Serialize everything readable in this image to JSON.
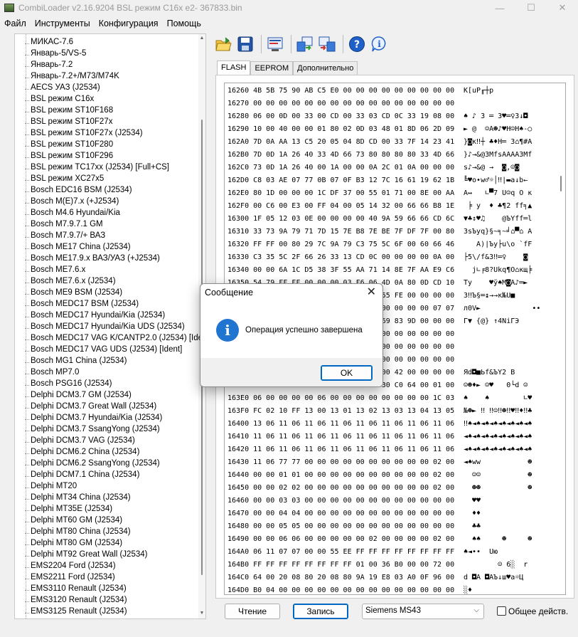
{
  "window": {
    "title": "CombiLoader v2.16.9204 BSL режим C16x e2- 367833.bin",
    "minimize": "—",
    "maximize": "☐",
    "close": "✕"
  },
  "menu": [
    "Файл",
    "Инструменты",
    "Конфигурация",
    "Помощь"
  ],
  "tree_items": [
    "МИКАС-7.6",
    "Январь-5/VS-5",
    "Январь-7.2",
    "Январь-7.2+/M73/M74K",
    "AECS УАЗ (J2534)",
    "BSL режим C16x",
    "BSL режим ST10F168",
    "BSL режим ST10F27x",
    "BSL режим ST10F27x (J2534)",
    "BSL режим ST10F280",
    "BSL режим ST10F296",
    "BSL режим TC17xx (J2534) [Full+CS]",
    "BSL режим XC27x5",
    "Bosch EDC16 BSM (J2534)",
    "Bosch M(E)7.x (+J2534)",
    "Bosch M4.6 Hyundai/Kia",
    "Bosch M7.9.7.1 GM",
    "Bosch M7.9.7/+ ВАЗ",
    "Bosch ME17 China (J2534)",
    "Bosch ME17.9.x ВАЗ/УАЗ (+J2534)",
    "Bosch ME7.6.x",
    "Bosch ME7.6.x (J2534)",
    "Bosch ME9 BSM (J2534)",
    "Bosch MEDC17 BSM (J2534)",
    "Bosch MEDC17 Hyundai/Kia (J2534)",
    "Bosch MEDC17 Hyundai/Kia UDS (J2534)",
    "Bosch MEDC17 VAG K/CANTP2.0 (J2534) [Ident]",
    "Bosch MEDC17 VAG UDS (J2534) [Ident]",
    "Bosch MG1 China (J2534)",
    "Bosch MP7.0",
    "Bosch PSG16 (J2534)",
    "Delphi DCM3.7 GM (J2534)",
    "Delphi DCM3.7 Great Wall (J2534)",
    "Delphi DCM3.7 Hyundai/Kia (J2534)",
    "Delphi DCM3.7 SsangYong (J2534)",
    "Delphi DCM3.7 VAG (J2534)",
    "Delphi DCM6.2 China (J2534)",
    "Delphi DCM6.2 SsangYong (J2534)",
    "Delphi DCM7.1 China (J2534)",
    "Delphi MT20",
    "Delphi MT34 China (J2534)",
    "Delphi MT35E (J2534)",
    "Delphi MT60 GM (J2534)",
    "Delphi MT80 China (J2534)",
    "Delphi MT80 GM (J2534)",
    "Delphi MT92 Great Wall (J2534)",
    "EMS2204 Ford (J2534)",
    "EMS2211 Ford (J2534)",
    "EMS3110 Renault (J2534)",
    "EMS3120 Renault (J2534)",
    "EMS3125 Renault (J2534)"
  ],
  "toolbar": [
    "open-icon",
    "save-icon",
    "edit-icon",
    "read-icon",
    "write-icon",
    "help-icon",
    "info-icon"
  ],
  "tabs": [
    "FLASH",
    "EEPROM",
    "Дополнительно"
  ],
  "hex_rows": [
    {
      "hex": "16260 4B 5B 75 90 AB C5 E0 00 00 00 00 00 00 00 00 00",
      "ascii": "K[uP╓┼р"
    },
    {
      "hex": "16270 00 00 00 00 00 00 00 00 00 00 00 00 00 00 00 00",
      "ascii": ""
    },
    {
      "hex": "16280 06 00 0D 00 33 00 CD 00 33 03 CD 0C 33 19 08 00",
      "ascii": "♠ ♪ 3 ═ 3♥═♀3↓◘"
    },
    {
      "hex": "16290 10 00 40 00 00 01 80 02 0D 03 48 01 8D 06 2D 09",
      "ascii": "► @  ☺А☻♪♥H☺Н♠-○"
    },
    {
      "hex": "162A0 7D 0A AA 13 C5 20 05 04 8D CD 00 33 7F 14 23 41",
      "ascii": "}◙к‼┼ ♣♦Н═ 3⌂¶#A"
    },
    {
      "hex": "162B0 7D 0D 1A 26 40 33 4D 66 73 80 80 80 80 33 4D 66",
      "ascii": "}♪→&@3MfsААААЗMf"
    },
    {
      "hex": "162C0 73 0D 1A 26 40 00 1A 00 00 0A 2C 01 0A 00 00 00",
      "ascii": "s♪→&@ →  ◙,☺◙"
    },
    {
      "hex": "162D0 C8 03 AE 07 77 0B 07 0F B3 12 7C 16 61 19 62 1B",
      "ascii": "╚♥о•w♂☼│‼|▬a↓b←"
    },
    {
      "hex": "162E0 80 1D 00 00 00 1C DF 37 00 55 01 71 00 8E 00 AA",
      "ascii": "А↔   ∟▀7 U☺q О к"
    },
    {
      "hex": "162F0 00 C6 00 E3 00 FF 04 00 05 14 32 00 66 66 B8 1E",
      "ascii": " ╞ у  ♦ ♣¶2 ff╕▲"
    },
    {
      "hex": "16300 1F 05 12 03 0E 00 00 00 00 40 9A 59 66 66 CD 6C",
      "ascii": "▼♣↕♥♫    @ЪYff═l"
    },
    {
      "hex": "16310 33 73 9A 79 71 7D 15 7E B8 7E BE 7F DF 7F 00 80",
      "ascii": "3sЪyq}§~╕~╛⌂▀⌂ А"
    },
    {
      "hex": "16320 FF FF 00 80 29 7C 9A 79 C3 75 5C 6F 00 60 66 46",
      "ascii": "   А)|Ъy├u\\o `fF"
    },
    {
      "hex": "16330 C3 35 5C 2F 66 26 33 13 CD 0C 00 00 00 00 0A 00",
      "ascii": "├5\\/f&3‼═♀    ◙"
    },
    {
      "hex": "16340 00 00 6A 1C D5 38 3F 55 AA 71 14 8E 7F AA E9 C6",
      "ascii": "  j∟╒8?Ukq¶О⌂кщ╞"
    },
    {
      "hex": "16350 54 79 FF FF 00 00 00 03 F6 06 4D 0A 80 0D CD 10",
      "ascii": "Ty    ♥ў♠M◙А♪═►"
    },
    {
      "hex": "16360 33 13 9A 15 CD 17 1A 1A AA FC 55 FE 00 00 00 00",
      "ascii": "3‼Ъ§═↨→→к№U■"
    },
    {
      "hex": "16370 AB 30 56 10 00 00 00 00 00 00 00 00 00 00 07 07",
      "ascii": "л0V►            ••"
    },
    {
      "hex": "16380 83 1F 00 20 7B 40 7D 00 AE 4E 69 83 9D 00 00 00",
      "ascii": "Г▼ {@} ↑4NiГЭ"
    },
    {
      "hex": "16390 00 00 00 00 00 00 00 00 00 00 00 00 00 00 00 00",
      "ascii": ""
    },
    {
      "hex": "163A0 00 00 00 00 00 00 00 00 00 00 00 00 00 00 00 00",
      "ascii": ""
    },
    {
      "hex": "163B0 00 00 00 00 00 00 00 00 00 00 00 00 00 00 00 00",
      "ascii": ""
    },
    {
      "hex": "163C0 9F 64 08 FE 9C 66 26 9A 59 32 00 42 00 00 00 00",
      "ascii": "Яd◘■Ьf&ЪY2 B"
    },
    {
      "hex": "163D0 01 02 04 10 00 41 03 00 00 00 30 C0 64 00 01 00",
      "ascii": "☺☻♦► ☺♥   0└d ☺"
    },
    {
      "hex": "163E0 06 00 00 00 00 06 00 00 00 00 00 00 00 00 1C 03",
      "ascii": "♠    ♠        ∟♥"
    },
    {
      "hex": "163F0 FC 02 10 FF 13 00 13 01 13 02 13 03 13 04 13 05",
      "ascii": "№☻► ‼ ‼☺‼☻‼♥‼♦‼♣"
    },
    {
      "hex": "16400 13 06 11 06 11 06 11 06 11 06 11 06 11 06 11 06",
      "ascii": "‼♠◄♠◄♠◄♠◄♠◄♠◄♠◄♠"
    },
    {
      "hex": "16410 11 06 11 06 11 06 11 06 11 06 11 06 11 06 11 06",
      "ascii": "◄♠◄♠◄♠◄♠◄♠◄♠◄♠◄♠"
    },
    {
      "hex": "16420 11 06 11 06 11 06 11 06 11 06 11 06 11 06 11 06",
      "ascii": "◄♠◄♠◄♠◄♠◄♠◄♠◄♠◄♠"
    },
    {
      "hex": "16430 11 06 77 77 00 00 00 00 00 00 00 00 00 00 02 00",
      "ascii": "◄♠ww           ☻"
    },
    {
      "hex": "16440 00 00 01 01 00 00 00 00 00 00 00 00 00 00 02 00",
      "ascii": "  ☺☺           ☻"
    },
    {
      "hex": "16450 00 00 02 02 00 00 00 00 00 00 00 00 00 00 02 00",
      "ascii": "  ☻☻           ☻"
    },
    {
      "hex": "16460 00 00 03 03 00 00 00 00 00 00 00 00 00 00 00 00",
      "ascii": "  ♥♥"
    },
    {
      "hex": "16470 00 00 04 04 00 00 00 00 00 00 00 00 00 00 00 00",
      "ascii": "  ♦♦"
    },
    {
      "hex": "16480 00 00 05 05 00 00 00 00 00 00 00 00 00 00 00 00",
      "ascii": "  ♣♣"
    },
    {
      "hex": "16490 00 00 06 06 00 00 00 00 00 02 00 00 00 00 02 00",
      "ascii": "  ♠♠     ☻     ☻"
    },
    {
      "hex": "164A0 06 11 07 07 00 00 55 EE FF FF FF FF FF FF FF FF",
      "ascii": "♠◄••  Uю"
    },
    {
      "hex": "164B0 FF FF FF FF FF FF FF FF 01 00 36 B0 00 00 72 00",
      "ascii": "        ☺ 6░  r"
    },
    {
      "hex": "164C0 64 00 20 08 80 20 08 80 9A 19 E8 03 A0 0F 96 00",
      "ascii": "d ◘А ◘АЪ↓ш♥а☼Ц"
    },
    {
      "hex": "164D0 B0 04 00 00 00 00 00 00 00 00 00 00 00 00 00 00",
      "ascii": "░♦"
    }
  ],
  "bottom": {
    "read_label": "Чтение",
    "write_label": "Запись",
    "ecu_selected": "Siemens MS43",
    "common_label": "Общее действ."
  },
  "dialog": {
    "title": "Сообщение",
    "close": "✕",
    "icon": "info-icon",
    "message": "Операция успешно завершена",
    "ok_label": "OK"
  },
  "colors": {
    "accent": "#0067c0",
    "info_icon": "#1f75d0"
  }
}
